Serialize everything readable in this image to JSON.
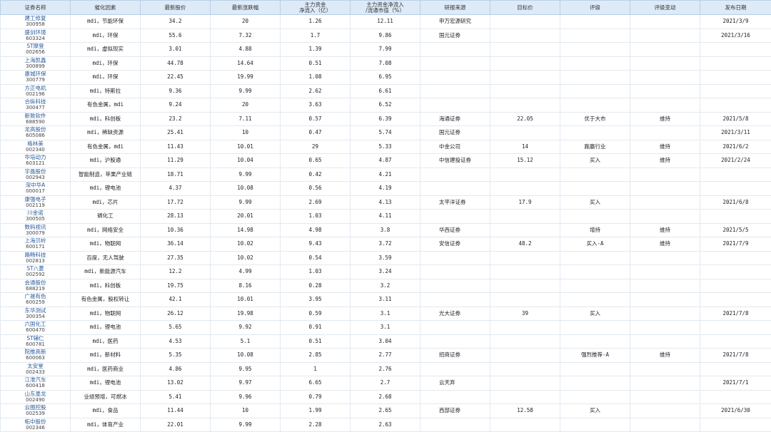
{
  "headers": [
    "证券名称",
    "催化因素",
    "最新股价",
    "最新涨跌幅",
    "主力资金\n净流入（亿）",
    "主力资金净流入\n/流通市值（%）",
    "研报来源",
    "目标价",
    "评级",
    "评级变动",
    "发布日期"
  ],
  "rows": [
    {
      "name": "建工修复",
      "code": "300958",
      "catalyst": "mdi，节能环保",
      "price": "34.2",
      "change": "20",
      "inflow": "1.26",
      "ratio": "12.11",
      "source": "申万宏源研究",
      "target": "",
      "rating": "",
      "rating_change": "",
      "date": "2021/3/9"
    },
    {
      "name": "盛剑环境",
      "code": "603324",
      "catalyst": "mdi，环保",
      "price": "55.6",
      "change": "7.32",
      "inflow": "1.7",
      "ratio": "9.86",
      "source": "国元证券",
      "target": "",
      "rating": "",
      "rating_change": "",
      "date": "2021/3/16"
    },
    {
      "name": "ST摩登",
      "code": "002656",
      "catalyst": "mdi，虚拟现实",
      "price": "3.01",
      "change": "4.88",
      "inflow": "1.39",
      "ratio": "7.99",
      "source": "",
      "target": "",
      "rating": "",
      "rating_change": "",
      "date": ""
    },
    {
      "name": "上海凯鑫",
      "code": "300899",
      "catalyst": "mdi，环保",
      "price": "44.78",
      "change": "14.64",
      "inflow": "0.51",
      "ratio": "7.08",
      "source": "",
      "target": "",
      "rating": "",
      "rating_change": "",
      "date": ""
    },
    {
      "name": "惠城环保",
      "code": "300779",
      "catalyst": "mdi，环保",
      "price": "22.45",
      "change": "19.99",
      "inflow": "1.08",
      "ratio": "6.95",
      "source": "",
      "target": "",
      "rating": "",
      "rating_change": "",
      "date": ""
    },
    {
      "name": "方正电机",
      "code": "002196",
      "catalyst": "mdi，特斯拉",
      "price": "9.36",
      "change": "9.99",
      "inflow": "2.62",
      "ratio": "6.61",
      "source": "",
      "target": "",
      "rating": "",
      "rating_change": "",
      "date": ""
    },
    {
      "name": "合纵科技",
      "code": "300477",
      "catalyst": "有色金属，mdi",
      "price": "9.24",
      "change": "20",
      "inflow": "3.63",
      "ratio": "6.52",
      "source": "",
      "target": "",
      "rating": "",
      "rating_change": "",
      "date": ""
    },
    {
      "name": "新致软件",
      "code": "688590",
      "catalyst": "mdi，科创板",
      "price": "23.2",
      "change": "7.11",
      "inflow": "0.57",
      "ratio": "6.39",
      "source": "海通证券",
      "target": "22.05",
      "rating": "优于大市",
      "rating_change": "维持",
      "date": "2021/5/8"
    },
    {
      "name": "龙高股份",
      "code": "605086",
      "catalyst": "mdi，稀缺资源",
      "price": "25.41",
      "change": "10",
      "inflow": "0.47",
      "ratio": "5.74",
      "source": "国元证券",
      "target": "",
      "rating": "",
      "rating_change": "",
      "date": "2021/3/11"
    },
    {
      "name": "格林美",
      "code": "002340",
      "catalyst": "有色金属，mdi",
      "price": "11.43",
      "change": "10.01",
      "inflow": "29",
      "ratio": "5.33",
      "source": "中金公司",
      "target": "14",
      "rating": "跑赢行业",
      "rating_change": "维持",
      "date": "2021/6/2"
    },
    {
      "name": "华培动力",
      "code": "603121",
      "catalyst": "mdi，沪股通",
      "price": "11.29",
      "change": "10.04",
      "inflow": "0.65",
      "ratio": "4.87",
      "source": "中信建投证券",
      "target": "15.12",
      "rating": "买入",
      "rating_change": "维持",
      "date": "2021/2/24"
    },
    {
      "name": "宇晶股份",
      "code": "002943",
      "catalyst": "智能制造，苹果产业链",
      "price": "18.71",
      "change": "9.99",
      "inflow": "0.42",
      "ratio": "4.21",
      "source": "",
      "target": "",
      "rating": "",
      "rating_change": "",
      "date": ""
    },
    {
      "name": "深中华A",
      "code": "000017",
      "catalyst": "mdi，锂电池",
      "price": "4.37",
      "change": "10.08",
      "inflow": "0.56",
      "ratio": "4.19",
      "source": "",
      "target": "",
      "rating": "",
      "rating_change": "",
      "date": ""
    },
    {
      "name": "康强电子",
      "code": "002119",
      "catalyst": "mdi，芯片",
      "price": "17.72",
      "change": "9.99",
      "inflow": "2.69",
      "ratio": "4.13",
      "source": "太平洋证券",
      "target": "17.9",
      "rating": "买入",
      "rating_change": "",
      "date": "2021/6/8"
    },
    {
      "name": "川金诺",
      "code": "300505",
      "catalyst": "磷化工",
      "price": "28.13",
      "change": "20.01",
      "inflow": "1.03",
      "ratio": "4.11",
      "source": "",
      "target": "",
      "rating": "",
      "rating_change": "",
      "date": ""
    },
    {
      "name": "数码视讯",
      "code": "300079",
      "catalyst": "mdi，网络安全",
      "price": "10.36",
      "change": "14.98",
      "inflow": "4.98",
      "ratio": "3.8",
      "source": "华西证券",
      "target": "",
      "rating": "增持",
      "rating_change": "维持",
      "date": "2021/5/5"
    },
    {
      "name": "上海贝岭",
      "code": "600171",
      "catalyst": "mdi，物联网",
      "price": "36.14",
      "change": "10.02",
      "inflow": "9.43",
      "ratio": "3.72",
      "source": "安信证券",
      "target": "48.2",
      "rating": "买入-A",
      "rating_change": "维持",
      "date": "2021/7/9"
    },
    {
      "name": "路畅科技",
      "code": "002813",
      "catalyst": "百度，无人驾驶",
      "price": "27.35",
      "change": "10.02",
      "inflow": "0.54",
      "ratio": "3.59",
      "source": "",
      "target": "",
      "rating": "",
      "rating_change": "",
      "date": ""
    },
    {
      "name": "ST八菱",
      "code": "002592",
      "catalyst": "mdi，新能源汽车",
      "price": "12.2",
      "change": "4.99",
      "inflow": "1.03",
      "ratio": "3.24",
      "source": "",
      "target": "",
      "rating": "",
      "rating_change": "",
      "date": ""
    },
    {
      "name": "会通股份",
      "code": "688219",
      "catalyst": "mdi，科创板",
      "price": "19.75",
      "change": "8.16",
      "inflow": "0.28",
      "ratio": "3.2",
      "source": "",
      "target": "",
      "rating": "",
      "rating_change": "",
      "date": ""
    },
    {
      "name": "广晟有色",
      "code": "600259",
      "catalyst": "有色金属，股权转让",
      "price": "42.1",
      "change": "10.01",
      "inflow": "3.95",
      "ratio": "3.11",
      "source": "",
      "target": "",
      "rating": "",
      "rating_change": "",
      "date": ""
    },
    {
      "name": "东华测试",
      "code": "300354",
      "catalyst": "mdi，物联网",
      "price": "26.12",
      "change": "19.98",
      "inflow": "0.59",
      "ratio": "3.1",
      "source": "光大证券",
      "target": "39",
      "rating": "买入",
      "rating_change": "",
      "date": "2021/7/8"
    },
    {
      "name": "六国化工",
      "code": "600470",
      "catalyst": "mdi，锂电池",
      "price": "5.65",
      "change": "9.92",
      "inflow": "0.91",
      "ratio": "3.1",
      "source": "",
      "target": "",
      "rating": "",
      "rating_change": "",
      "date": ""
    },
    {
      "name": "ST辅仁",
      "code": "600781",
      "catalyst": "mdi，医药",
      "price": "4.53",
      "change": "5.1",
      "inflow": "0.51",
      "ratio": "3.04",
      "source": "",
      "target": "",
      "rating": "",
      "rating_change": "",
      "date": ""
    },
    {
      "name": "院推高新",
      "code": "600063",
      "catalyst": "mdi，新材料",
      "price": "5.35",
      "change": "10.08",
      "inflow": "2.85",
      "ratio": "2.77",
      "source": "招商证券",
      "target": "",
      "rating": "强烈推荐-A",
      "rating_change": "维持",
      "date": "2021/7/8"
    },
    {
      "name": "太安堂",
      "code": "002433",
      "catalyst": "mdi，医药商业",
      "price": "4.86",
      "change": "9.95",
      "inflow": "1",
      "ratio": "2.76",
      "source": "",
      "target": "",
      "rating": "",
      "rating_change": "",
      "date": ""
    },
    {
      "name": "江淮汽车",
      "code": "600418",
      "catalyst": "mdi，锂电池",
      "price": "13.02",
      "change": "9.97",
      "inflow": "6.65",
      "ratio": "2.7",
      "source": "云天弃",
      "target": "",
      "rating": "",
      "rating_change": "",
      "date": "2021/7/1"
    },
    {
      "name": "山东墨龙",
      "code": "002490",
      "catalyst": "业绩预增，可燃冰",
      "price": "5.41",
      "change": "9.96",
      "inflow": "0.79",
      "ratio": "2.68",
      "source": "",
      "target": "",
      "rating": "",
      "rating_change": "",
      "date": ""
    },
    {
      "name": "云图控股",
      "code": "002539",
      "catalyst": "mdi，食品",
      "price": "11.44",
      "change": "10",
      "inflow": "1.99",
      "ratio": "2.65",
      "source": "西部证券",
      "target": "12.58",
      "rating": "买入",
      "rating_change": "",
      "date": "2021/6/30"
    },
    {
      "name": "柘中股份",
      "code": "002346",
      "catalyst": "mdi，体育产业",
      "price": "22.01",
      "change": "9.99",
      "inflow": "2.28",
      "ratio": "2.63",
      "source": "",
      "target": "",
      "rating": "",
      "rating_change": "",
      "date": ""
    }
  ]
}
